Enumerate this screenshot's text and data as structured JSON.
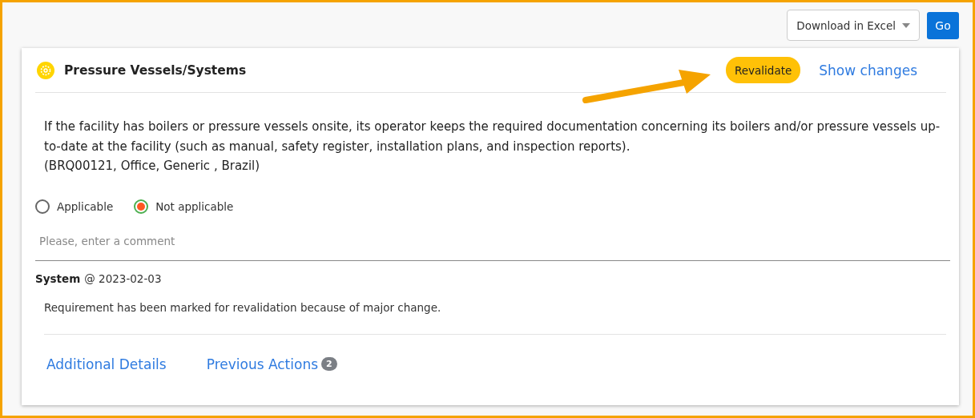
{
  "toolbar": {
    "export_select": {
      "value": "Download in Excel"
    },
    "go_button": "Go"
  },
  "requirement": {
    "title": "Pressure Vessels/Systems",
    "revalidate_button": "Revalidate",
    "show_changes_link": "Show changes",
    "description": "If the facility has boilers or pressure vessels onsite, its operator keeps the required documentation concerning its boilers and/or pressure vessels up-to-date at the facility (such as manual, safety register, installation plans, and inspection reports).",
    "reference": "(BRQ00121, Office, Generic , Brazil)",
    "options": [
      {
        "label": "Applicable",
        "selected": false
      },
      {
        "label": "Not applicable",
        "selected": true
      }
    ],
    "comment": {
      "placeholder": "Please, enter a comment"
    },
    "history": {
      "author": "System",
      "date": "@ 2023-02-03",
      "message": "Requirement has been marked for revalidation because of major change."
    },
    "tabs": [
      {
        "label": "Additional Details"
      },
      {
        "label": "Previous Actions",
        "badge": "2"
      }
    ]
  }
}
